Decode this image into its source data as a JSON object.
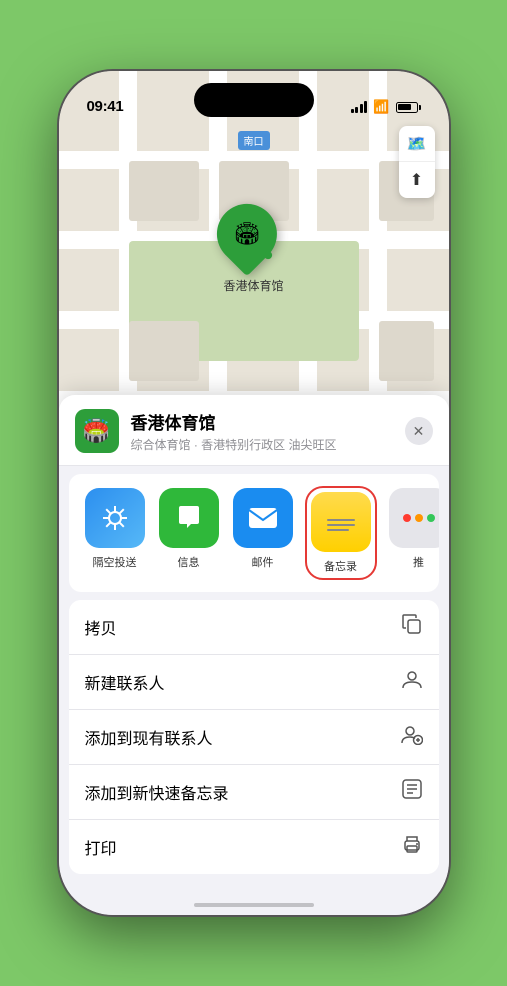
{
  "statusBar": {
    "time": "09:41",
    "locationArrow": "▶"
  },
  "map": {
    "locationLabel": "南口",
    "stadiumName": "香港体育馆",
    "stadiumEmoji": "🏟️"
  },
  "mapControls": {
    "mapIcon": "🗺️",
    "locationIcon": "⬆"
  },
  "venueCard": {
    "name": "香港体育馆",
    "desc": "综合体育馆 · 香港特别行政区 油尖旺区",
    "emoji": "🏟️",
    "closeLabel": "✕"
  },
  "shareItems": [
    {
      "id": "airdrop",
      "label": "隔空投送",
      "type": "airdrop"
    },
    {
      "id": "messages",
      "label": "信息",
      "type": "messages"
    },
    {
      "id": "mail",
      "label": "邮件",
      "type": "mail"
    },
    {
      "id": "notes",
      "label": "备忘录",
      "type": "notes"
    },
    {
      "id": "more",
      "label": "推",
      "type": "more"
    }
  ],
  "actions": [
    {
      "label": "拷贝",
      "icon": "copy"
    },
    {
      "label": "新建联系人",
      "icon": "person"
    },
    {
      "label": "添加到现有联系人",
      "icon": "person-add"
    },
    {
      "label": "添加到新快速备忘录",
      "icon": "note"
    },
    {
      "label": "打印",
      "icon": "print"
    }
  ],
  "moreDots": [
    {
      "color": "#ff3b30"
    },
    {
      "color": "#ff9500"
    },
    {
      "color": "#34c759"
    }
  ]
}
